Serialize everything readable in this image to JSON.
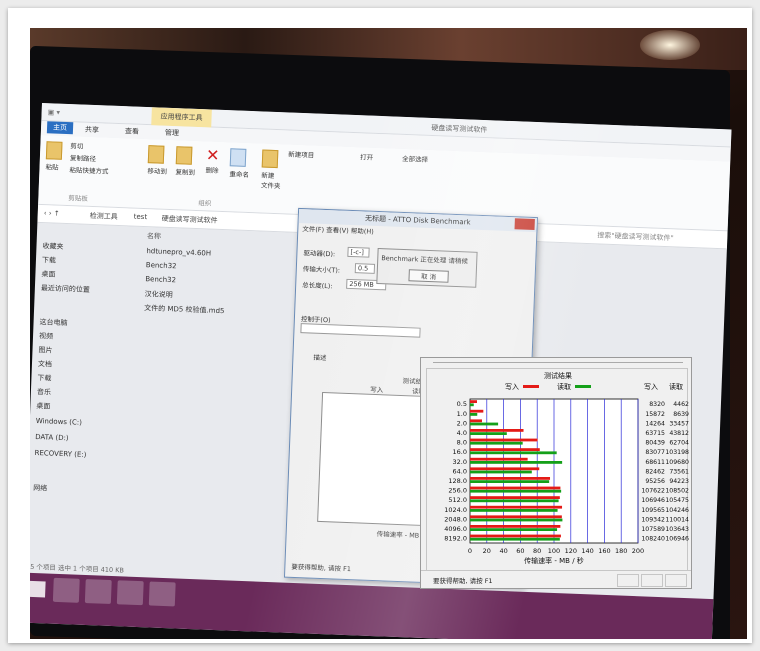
{
  "explorer": {
    "title": "硬盘读写测试软件",
    "context_tab": "应用程序工具",
    "tabs": [
      "主页",
      "共享",
      "查看",
      "管理"
    ],
    "ribbon": {
      "paste": "粘贴",
      "cut": "剪切",
      "copy_path": "复制路径",
      "paste_shortcut": "粘贴快捷方式",
      "clipboard_group": "剪贴板",
      "move_to": "移动到",
      "copy_to": "复制到",
      "delete": "删除",
      "rename": "重命名",
      "organize_group": "组织",
      "new_folder": "新建\n文件夹",
      "new_item": "新建项目",
      "open": "打开",
      "select_all": "全部选择"
    },
    "address": [
      "检测工具",
      "test",
      "硬盘读写测试软件"
    ],
    "search_placeholder": "搜索\"硬盘读写测试软件\"",
    "column_name": "名称",
    "files": [
      "hdtunepro_v4.60H",
      "Bench32",
      "Bench32",
      "汉化说明",
      "文件的 MD5 校验值.md5"
    ],
    "nav": [
      "收藏夹",
      "下载",
      "桌面",
      "最近访问的位置",
      "这台电脑",
      "视频",
      "图片",
      "文档",
      "下载",
      "音乐",
      "桌面",
      "Windows (C:)",
      "DATA (D:)",
      "RECOVERY (E:)",
      "网络"
    ],
    "status": "5 个项目    选中 1 个项目 410 KB"
  },
  "atto_window": {
    "title": "无标题 - ATTO Disk Benchmark",
    "menu": "文件(F)  查看(V)  帮助(H)",
    "drive_label": "驱动器(D):",
    "drive_value": "[-c-]",
    "transfer_label": "传输大小(T):",
    "transfer_value": "0.5",
    "total_label": "总长度(L):",
    "total_value": "256 MB",
    "benchmark_status": "Benchmark 正在处理  请稍候",
    "cancel": "取 消",
    "controlled_by": "控制于(O)",
    "description": "描述",
    "results_title": "测试结果",
    "write_label": "写入",
    "read_label": "读取",
    "axis_caption": "传输速率 - MB / 秒",
    "help": "要获得帮助, 请按 F1"
  },
  "inset": {
    "status_text": "要获得帮助, 请按 F1"
  },
  "chart_data": {
    "type": "bar",
    "title": "测试结果",
    "xlabel": "传输速率 - MB / 秒",
    "ylabel": "",
    "legend": [
      "写入",
      "读取"
    ],
    "legend_placement": "top-center",
    "column_headers": [
      "写入",
      "读取"
    ],
    "categories": [
      "0.5",
      "1.0",
      "2.0",
      "4.0",
      "8.0",
      "16.0",
      "32.0",
      "64.0",
      "128.0",
      "256.0",
      "512.0",
      "1024.0",
      "2048.0",
      "4096.0",
      "8192.0"
    ],
    "series": [
      {
        "name": "写入",
        "color": "#e41b17",
        "values": [
          8320,
          15872,
          14264,
          63715,
          80439,
          83077,
          68611,
          82462,
          95256,
          107622,
          106946,
          109565,
          109342,
          107589,
          108240
        ]
      },
      {
        "name": "读取",
        "color": "#14a019",
        "values": [
          4462,
          8639,
          33457,
          43812,
          62704,
          103198,
          109680,
          73561,
          94223,
          108502,
          105475,
          104246,
          110014,
          103643,
          106946
        ]
      }
    ],
    "value_unit_scale": 1000,
    "xlim": [
      0,
      200
    ],
    "xticks": [
      "0",
      "20",
      "40",
      "60",
      "80",
      "100",
      "120",
      "140",
      "160",
      "180",
      "200"
    ],
    "grid": true
  },
  "colors": {
    "write": "#e41b17",
    "read": "#14a019",
    "grid": "#2a2ad8",
    "taskbar": "#6a2a5a"
  }
}
